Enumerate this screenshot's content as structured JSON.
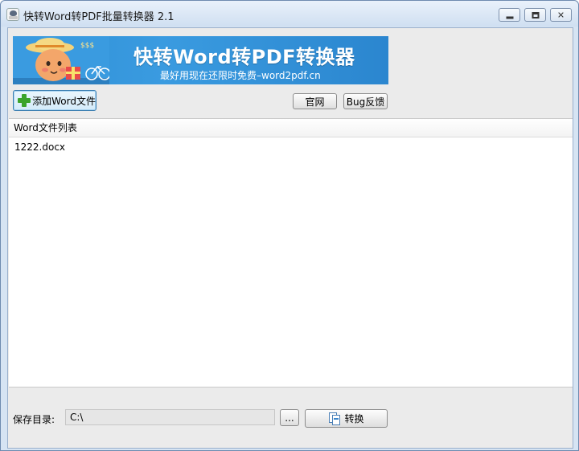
{
  "window": {
    "title": "快转Word转PDF批量转换器 2.1",
    "controls": {
      "minimize": "–",
      "maximize": "□",
      "close": "✕"
    }
  },
  "banner": {
    "title": "快转Word转PDF转换器",
    "subtitle": "最好用现在还限时免费–word2pdf.cn",
    "art_text": "$$$"
  },
  "toolbar": {
    "add_label": "添加Word文件",
    "website_label": "官网",
    "bug_label": "Bug反馈"
  },
  "file_list": {
    "header": "Word文件列表",
    "items": [
      "1222.docx"
    ]
  },
  "footer": {
    "save_dir_label": "保存目录:",
    "save_dir_value": "C:\\",
    "browse_label": "...",
    "convert_label": "转换"
  },
  "colors": {
    "banner_blue": "#2f8fd6",
    "plus_green": "#3ba32b",
    "title_bar": "#d6e4f3"
  }
}
